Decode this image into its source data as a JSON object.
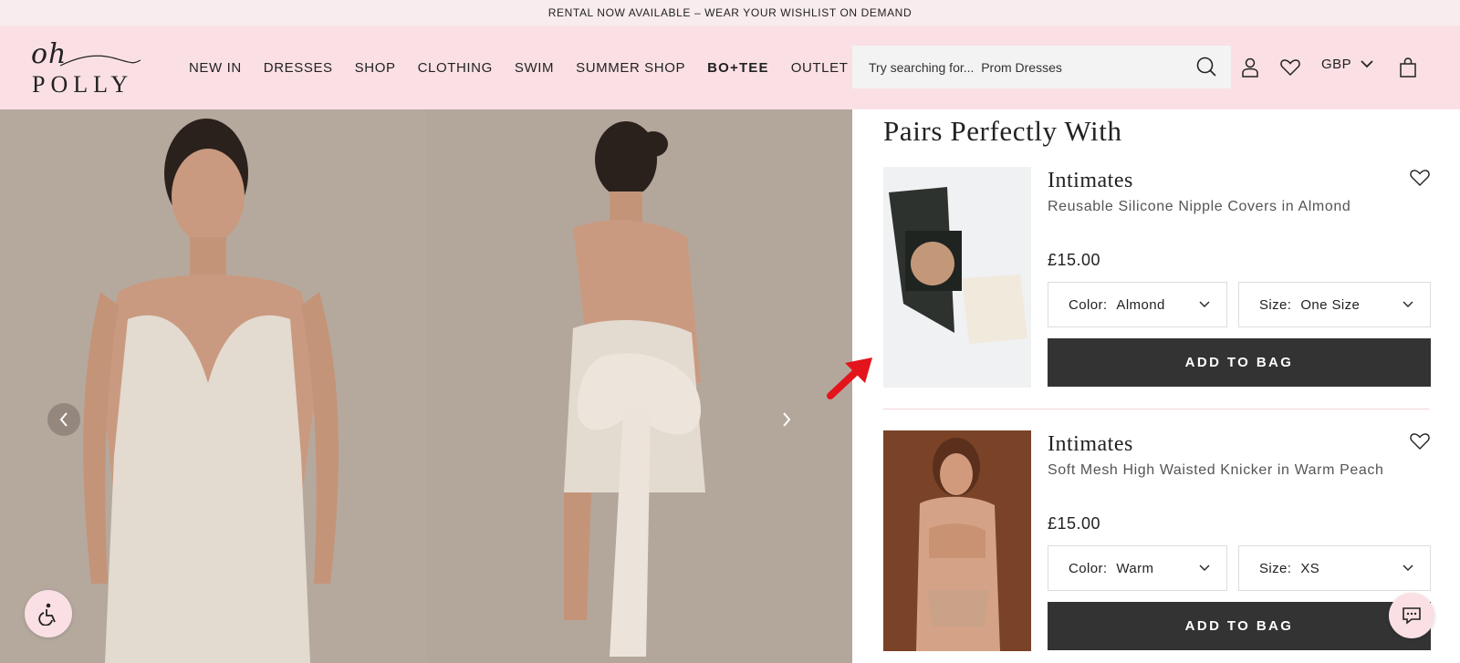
{
  "announcement": "RENTAL NOW AVAILABLE – WEAR YOUR WISHLIST ON DEMAND",
  "logo": {
    "top": "oh",
    "bottom": "POLLY"
  },
  "nav": [
    {
      "label": "NEW IN",
      "bold": false
    },
    {
      "label": "DRESSES",
      "bold": false
    },
    {
      "label": "SHOP",
      "bold": false
    },
    {
      "label": "CLOTHING",
      "bold": false
    },
    {
      "label": "SWIM",
      "bold": false
    },
    {
      "label": "SUMMER SHOP",
      "bold": false
    },
    {
      "label": "BO+TEE",
      "bold": true
    },
    {
      "label": "OUTLET",
      "bold": false
    }
  ],
  "search": {
    "placeholder": "Try searching for...  Prom Dresses",
    "icon": "search-icon"
  },
  "header_icons": [
    "account-icon",
    "heart-icon",
    "bag-icon"
  ],
  "currency": "GBP",
  "section_title": "Pairs Perfectly With",
  "products": [
    {
      "category": "Intimates",
      "name": "Reusable Silicone Nipple Covers in Almond",
      "price": "£15.00",
      "color_label": "Color:",
      "color_value": "Almond",
      "size_label": "Size:",
      "size_value": "One Size",
      "cta": "ADD TO BAG"
    },
    {
      "category": "Intimates",
      "name": "Soft Mesh High Waisted Knicker in Warm Peach",
      "price": "£15.00",
      "color_label": "Color:",
      "color_value": "Warm",
      "size_label": "Size:",
      "size_value": "XS",
      "cta": "ADD TO BAG"
    }
  ],
  "colors": {
    "header_bg": "#fae0e4",
    "announce_bg": "#f9ecee",
    "button_bg": "#333333",
    "annotation_arrow": "#e3141b"
  }
}
